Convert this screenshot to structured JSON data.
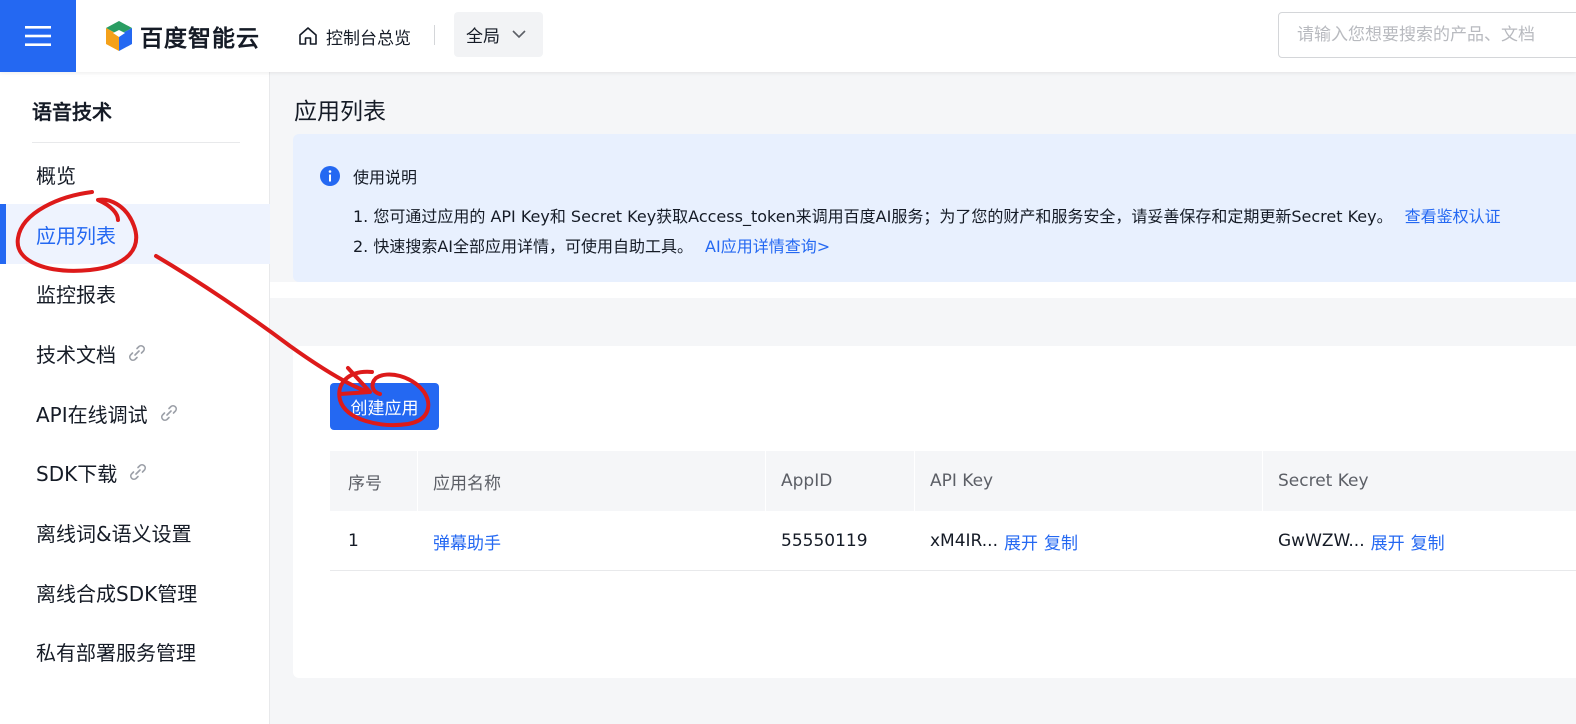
{
  "topbar": {
    "brand": "百度智能云",
    "home_label": "控制台总览",
    "region_label": "全局",
    "search_placeholder": "请输入您想要搜索的产品、文档",
    "icons": [
      "menu-icon",
      "cube-logo-icon",
      "home-icon",
      "chevron-down-icon"
    ],
    "accent": "#2468f2"
  },
  "sidebar": {
    "title": "语音技术",
    "items": [
      {
        "label": "概览",
        "active": false,
        "external": false
      },
      {
        "label": "应用列表",
        "active": true,
        "external": false
      },
      {
        "label": "监控报表",
        "active": false,
        "external": false
      },
      {
        "label": "技术文档",
        "active": false,
        "external": true
      },
      {
        "label": "API在线调试",
        "active": false,
        "external": true
      },
      {
        "label": "SDK下载",
        "active": false,
        "external": true
      },
      {
        "label": "离线词&语义设置",
        "active": false,
        "external": false
      },
      {
        "label": "离线合成SDK管理",
        "active": false,
        "external": false
      },
      {
        "label": "私有部署服务管理",
        "active": false,
        "external": false
      }
    ]
  },
  "main": {
    "page_title": "应用列表",
    "notice": {
      "title": "使用说明",
      "line1": "1. 您可通过应用的 API Key和 Secret Key获取Access_token来调用百度AI服务；为了您的财产和服务安全，请妥善保存和定期更新Secret Key。",
      "line1_link": "查看鉴权认证",
      "line2": "2. 快速搜索AI全部应用详情，可使用自助工具。",
      "line2_link": "AI应用详情查询>"
    },
    "create_button": "创建应用",
    "table": {
      "headers": [
        "序号",
        "应用名称",
        "AppID",
        "API Key",
        "Secret Key"
      ],
      "rows": [
        {
          "index": "1",
          "name": "弹幕助手",
          "appid": "55550119",
          "api_key": "xM4IR...",
          "secret_key": "GwWZW...",
          "expand": "展开",
          "copy": "复制"
        }
      ]
    }
  },
  "annotation_color": "#dd1a1a"
}
